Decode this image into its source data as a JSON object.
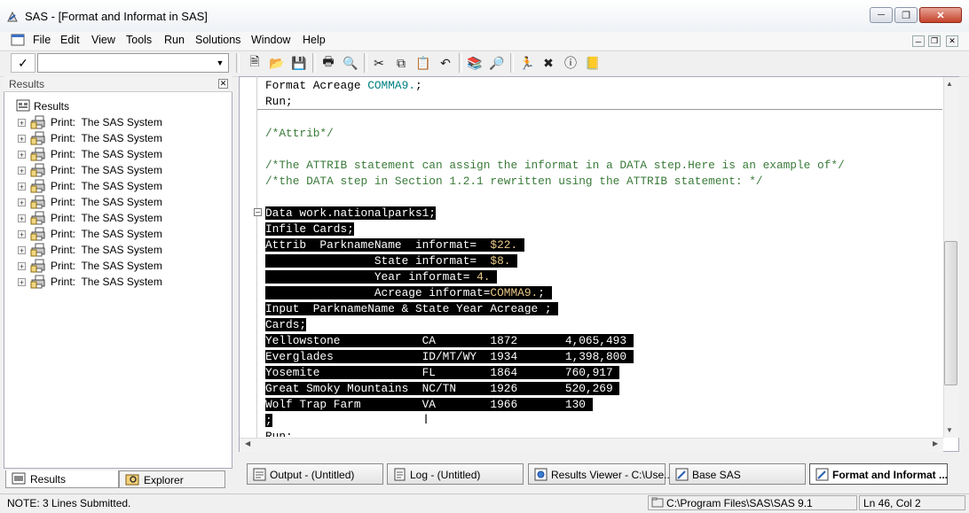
{
  "window": {
    "title": "SAS - [Format and Informat in SAS]"
  },
  "menu": [
    "File",
    "Edit",
    "View",
    "Tools",
    "Run",
    "Solutions",
    "Window",
    "Help"
  ],
  "toolbar": {
    "command_value": "",
    "icons": [
      "new-icon",
      "open-icon",
      "save-icon",
      "print-icon",
      "print-preview-icon",
      "cut-icon",
      "copy-icon",
      "paste-icon",
      "undo-icon",
      "libraries-icon",
      "explorer-find-icon",
      "submit-run-icon",
      "clear-all-icon",
      "help-icon",
      "sas-library-icon"
    ]
  },
  "results_pane": {
    "title": "Results",
    "root": "Results",
    "items": [
      {
        "prefix": "Print:",
        "label": "The SAS System"
      },
      {
        "prefix": "Print:",
        "label": "The SAS System"
      },
      {
        "prefix": "Print:",
        "label": "The SAS System"
      },
      {
        "prefix": "Print:",
        "label": "The SAS System"
      },
      {
        "prefix": "Print:",
        "label": "The SAS System"
      },
      {
        "prefix": "Print:",
        "label": "The SAS System"
      },
      {
        "prefix": "Print:",
        "label": "The SAS System"
      },
      {
        "prefix": "Print:",
        "label": "The SAS System"
      },
      {
        "prefix": "Print:",
        "label": "The SAS System"
      },
      {
        "prefix": "Print:",
        "label": "The SAS System"
      },
      {
        "prefix": "Print:",
        "label": "The SAS System"
      }
    ],
    "tabs": [
      "Results",
      "Explorer"
    ]
  },
  "editor": {
    "lines": {
      "l1a": "Format Acreage ",
      "l1b": "COMMA9.",
      "l1c": ";",
      "l2": "Run;",
      "l3": "/*Attrib*/",
      "l4": "/*The ATTRIB statement can assign the informat in a DATA step.Here is an example of*/",
      "l5": "/*the DATA step in Section 1.2.1 rewritten using the ATTRIB statement: */",
      "l6": "Data work.nationalparks1;",
      "l7": "Infile Cards;",
      "l8a": "Attrib  ParknameName  informat=  ",
      "l8b": "$22.",
      "l8c": " ",
      "l9a": "                State informat=  ",
      "l9b": "$8.",
      "l9c": " ",
      "l10a": "                Year informat= ",
      "l10b": "4.",
      "l10c": " ",
      "l11a": "                Acreage informat=",
      "l11b": "COMMA9.",
      "l11c": "; ",
      "l12": "Input  ParknameName & State Year Acreage ; ",
      "l13": "Cards;",
      "l14": "Yellowstone            CA        1872       4,065,493 ",
      "l15": "Everglades             ID/MT/WY  1934       1,398,800 ",
      "l16": "Yosemite               FL        1864       760,917 ",
      "l17": "Great Smoky Mountains  NC/TN     1926       520,269 ",
      "l18": "Wolf Trap Farm         VA        1966       130 ",
      "l19": ";",
      "l20": "Run;"
    }
  },
  "window_tabs": [
    {
      "label": "Output - (Untitled)"
    },
    {
      "label": "Log - (Untitled)"
    },
    {
      "label": "Results Viewer - C:\\Use..."
    },
    {
      "label": "Base SAS"
    },
    {
      "label": "Format and Informat ..."
    }
  ],
  "status": {
    "note": "NOTE:  3 Lines Submitted.",
    "path": "C:\\Program Files\\SAS\\SAS 9.1",
    "position": "Ln 46, Col 2"
  }
}
